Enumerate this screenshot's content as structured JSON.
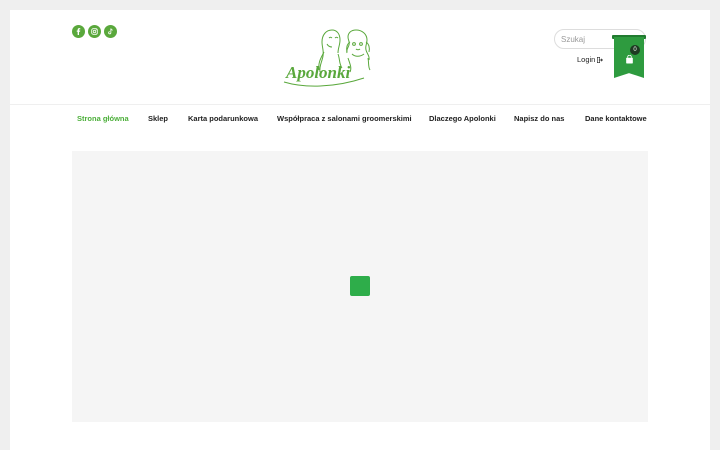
{
  "header": {
    "socials": [
      {
        "icon": "facebook-icon"
      },
      {
        "icon": "instagram-icon"
      },
      {
        "icon": "tiktok-icon"
      }
    ],
    "logo_text": "Apolonki",
    "search": {
      "placeholder": "Szukaj"
    },
    "login_label": "Login",
    "cart": {
      "count": "0"
    }
  },
  "nav": {
    "items": [
      {
        "label": "Strona główna",
        "active": true
      },
      {
        "label": "Sklep"
      },
      {
        "label": "Karta podarunkowa"
      },
      {
        "label": "Współpraca z salonami groomerskimi"
      },
      {
        "label": "Dlaczego Apolonki"
      },
      {
        "label": "Napisz do nas"
      },
      {
        "label": "Dane kontaktowe"
      }
    ]
  },
  "colors": {
    "brand_green": "#5aa83c",
    "cart_green": "#2e9b3f",
    "active_nav": "#4caf3a",
    "loader": "#2ead4a"
  }
}
